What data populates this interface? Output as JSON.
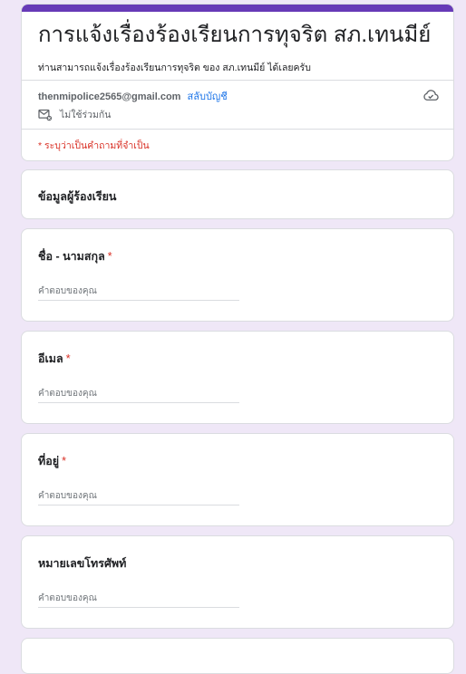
{
  "form": {
    "title": "การแจ้งเรื่องร้องเรียนการทุจริต สภ.เทนมีย์",
    "description": "ท่านสามารถแจ้งเรื่องร้องเรียนการทุจริต ของ สภ.เทนมีย์ ได้เลยครับ",
    "accent_color": "#673ab7"
  },
  "account": {
    "email": "thenmipolice2565@gmail.com",
    "switch_label": "สลับบัญชี",
    "not_shared_label": "ไม่ใช้ร่วมกัน",
    "cloud_icon": "cloud-saved-icon",
    "mail_icon": "mail-not-shared-icon"
  },
  "required_note": "* ระบุว่าเป็นคำถามที่จำเป็น",
  "section": {
    "title": "ข้อมูลผู้ร้องเรียน"
  },
  "questions": [
    {
      "label": "ชื่อ - นามสกุล",
      "required_mark": "*",
      "placeholder": "คำตอบของคุณ"
    },
    {
      "label": "อีเมล",
      "required_mark": "*",
      "placeholder": "คำตอบของคุณ"
    },
    {
      "label": "ที่อยู่",
      "required_mark": "*",
      "placeholder": "คำตอบของคุณ"
    },
    {
      "label": "หมายเลขโทรศัพท์",
      "required_mark": "",
      "placeholder": "คำตอบของคุณ"
    }
  ],
  "colors": {
    "background": "#efe7f7",
    "required": "#d93025",
    "link": "#1a73e8"
  }
}
